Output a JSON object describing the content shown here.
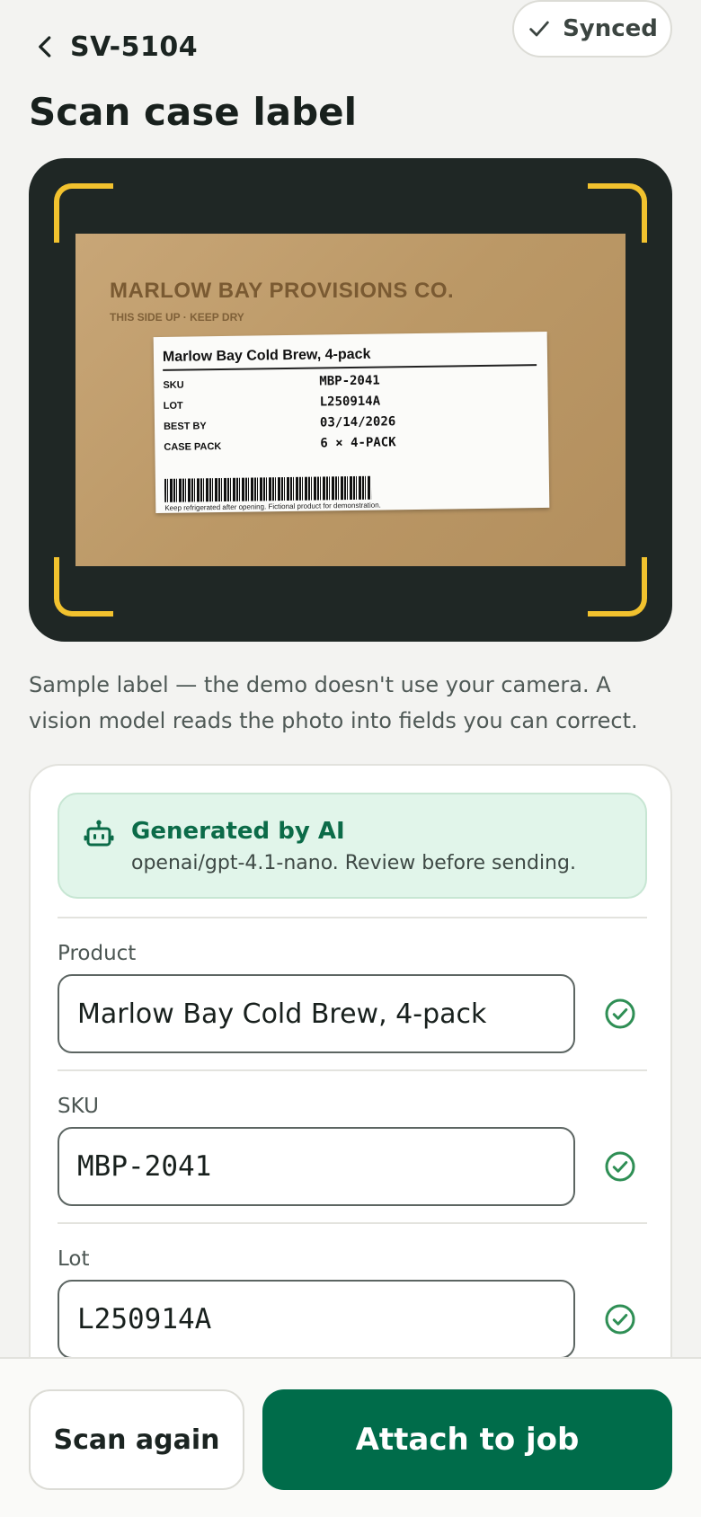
{
  "header": {
    "job_id": "SV-5104",
    "sync_status": "Synced",
    "title": "Scan case label"
  },
  "viewport": {
    "carton_brand": "MARLOW BAY PROVISIONS CO.",
    "carton_sub": "THIS SIDE UP · KEEP DRY",
    "label": {
      "title": "Marlow Bay Cold Brew, 4-pack",
      "rows": [
        {
          "key": "SKU",
          "value": "MBP-2041"
        },
        {
          "key": "LOT",
          "value": "L250914A"
        },
        {
          "key": "BEST BY",
          "value": "03/14/2026"
        },
        {
          "key": "CASE PACK",
          "value": "6 × 4-PACK"
        }
      ],
      "footnote": "Keep refrigerated after opening. Fictional product for demonstration."
    }
  },
  "caption": "Sample label — the demo doesn't use your camera. A vision model reads the photo into fields you can correct.",
  "ai_banner": {
    "title": "Generated by AI",
    "subtitle": "openai/gpt-4.1-nano. Review before sending."
  },
  "fields": [
    {
      "label": "Product",
      "value": "Marlow Bay Cold Brew, 4-pack"
    },
    {
      "label": "SKU",
      "value": "MBP-2041"
    },
    {
      "label": "Lot",
      "value": "L250914A"
    }
  ],
  "actions": {
    "scan_again": "Scan again",
    "attach": "Attach to job"
  },
  "colors": {
    "accent": "#006c4a",
    "ai_banner_bg": "#e1f5ea",
    "frame_corners": "#f2c22e"
  }
}
